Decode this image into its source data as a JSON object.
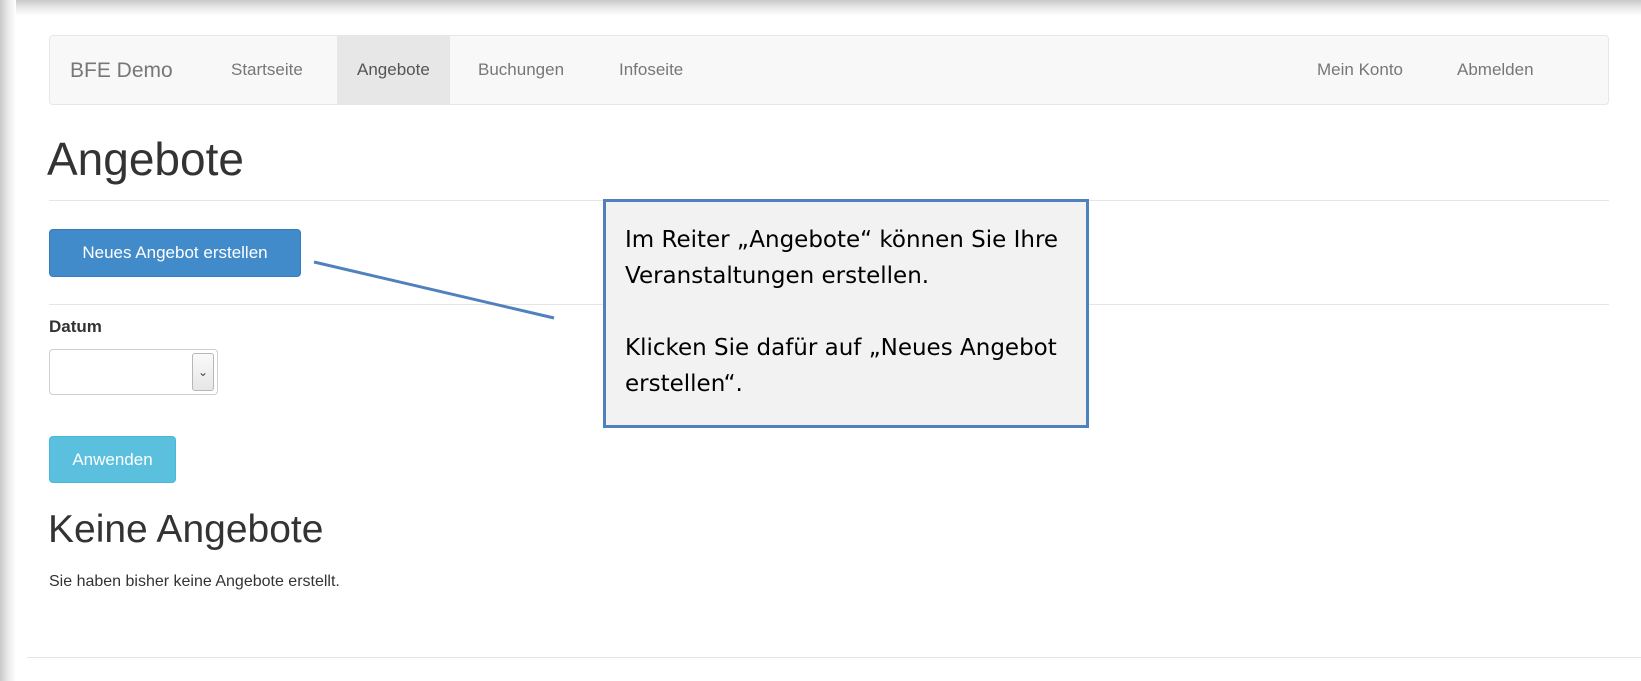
{
  "navbar": {
    "brand": "BFE Demo",
    "items": [
      "Startseite",
      "Angebote",
      "Buchungen",
      "Infoseite"
    ],
    "right_items": [
      "Mein Konto",
      "Abmelden"
    ]
  },
  "page": {
    "title": "Angebote",
    "new_button": "Neues Angebot erstellen",
    "filter_label": "Datum",
    "filter_value": "",
    "apply_button": "Anwenden",
    "empty_title": "Keine Angebote",
    "empty_text": "Sie haben bisher keine Angebote erstellt."
  },
  "callout": {
    "paragraph1": "Im Reiter „Angebote“ können Sie Ihre Veranstaltungen erstellen.",
    "paragraph2": "Klicken Sie dafür auf „Neues Angebot erstellen“."
  },
  "colors": {
    "primary": "#428bca",
    "info": "#5bc0de",
    "callout_border": "#4f81bd"
  },
  "icons": {
    "select_arrow": "chevron-down-icon"
  }
}
